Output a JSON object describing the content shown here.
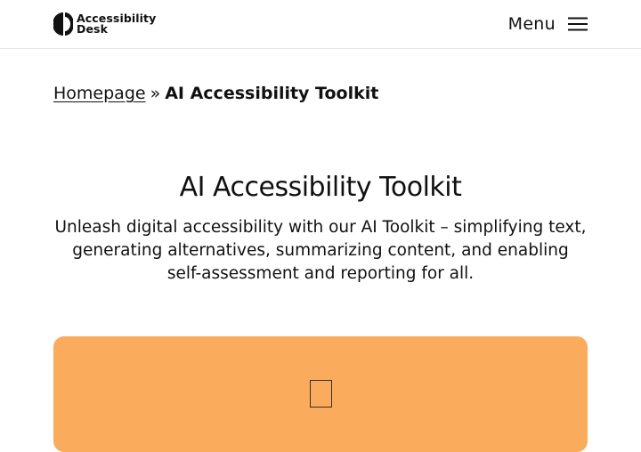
{
  "header": {
    "logo_line1": "Accessibility",
    "logo_line2": "Desk",
    "menu_label": "Menu"
  },
  "breadcrumb": {
    "home": "Homepage",
    "separator": "»",
    "current": "AI Accessibility Toolkit"
  },
  "main": {
    "title": "AI Accessibility Toolkit",
    "intro": "Unleash digital accessibility with our AI Toolkit – simplifying text, generating alternatives, summarizing content, and enabling self-assessment and reporting for all."
  },
  "card": {
    "icon": "missing-glyph-icon",
    "background": "#fbab5c"
  }
}
